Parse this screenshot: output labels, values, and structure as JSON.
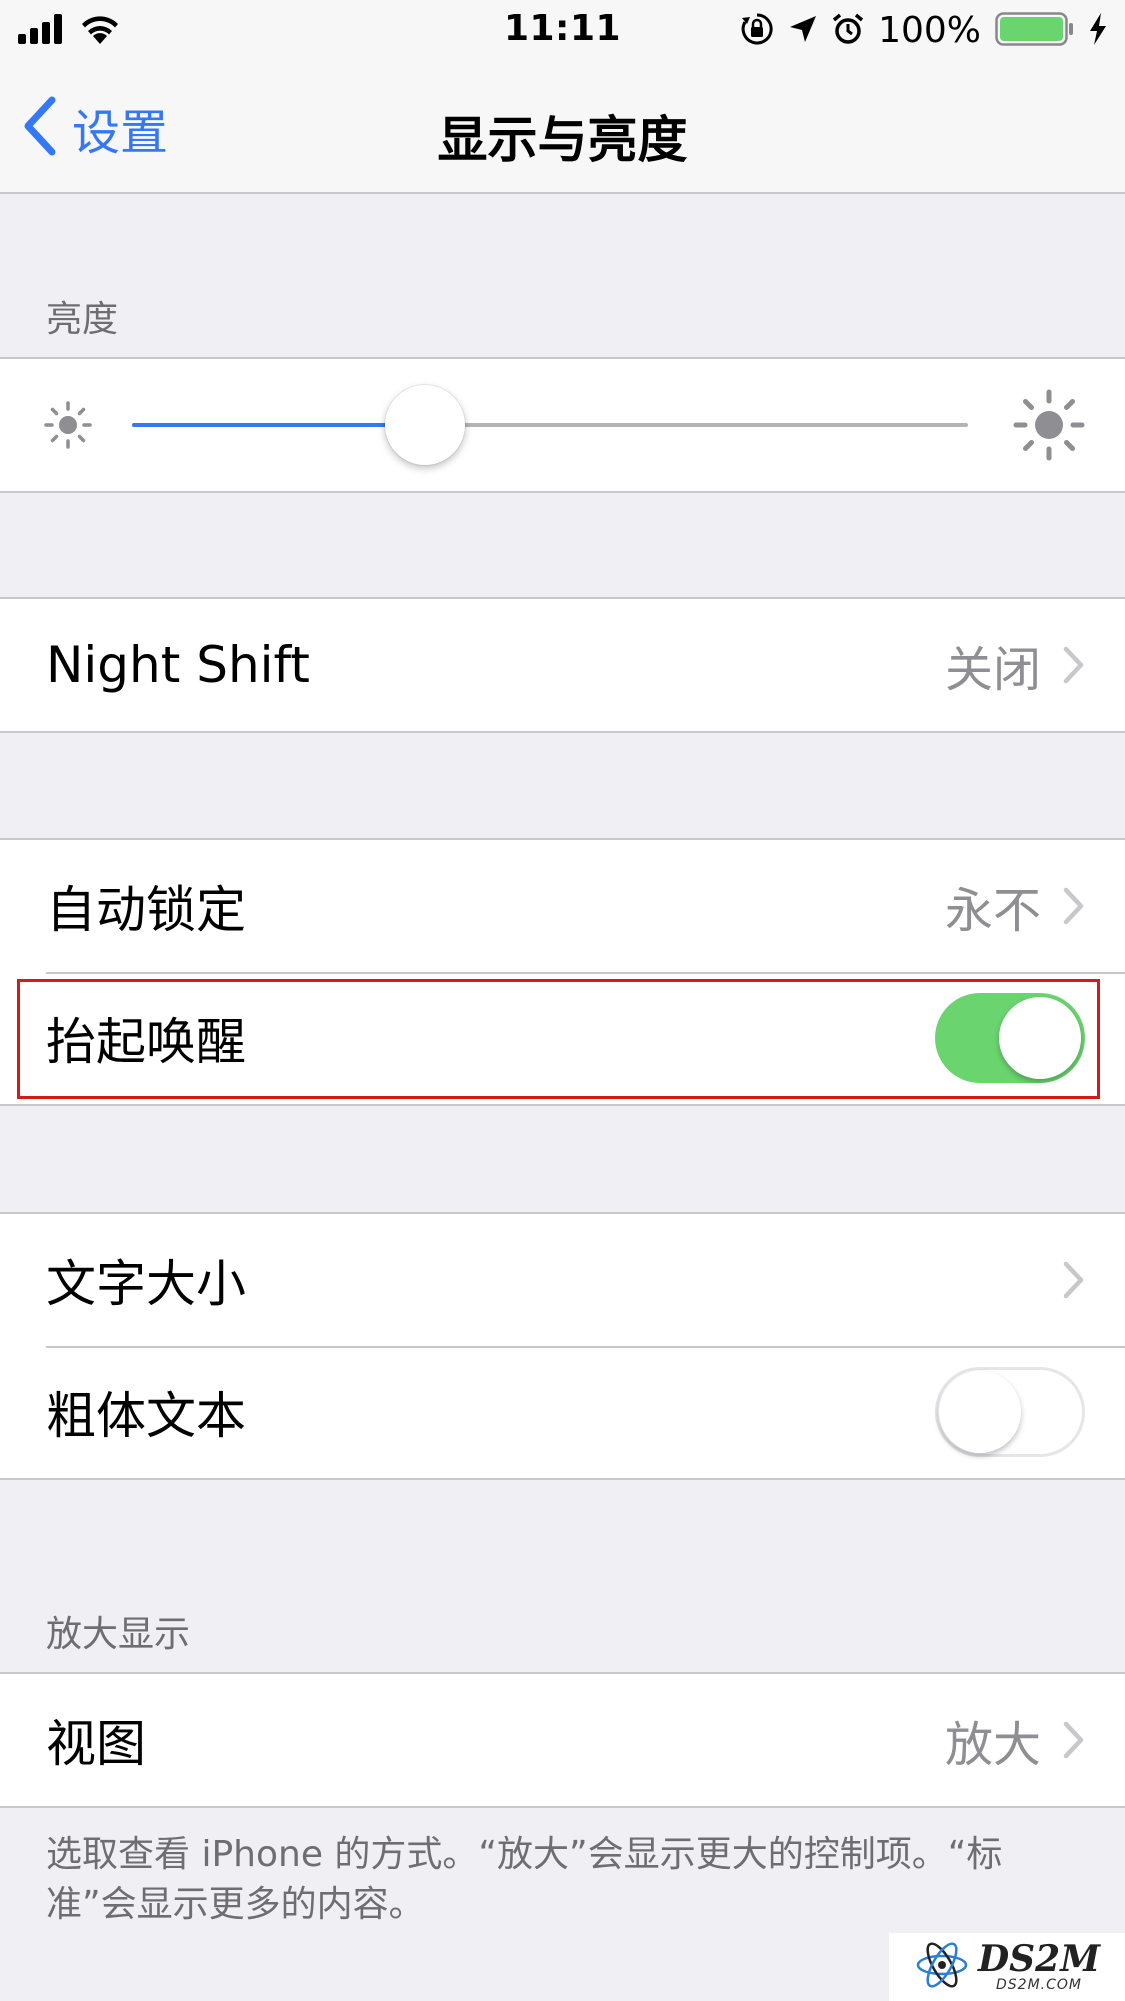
{
  "status_bar": {
    "time": "11:11",
    "battery_percent": "100%",
    "battery_level": 1.0,
    "icons": [
      "signal-icon",
      "wifi-icon",
      "orientation-lock-icon",
      "location-icon",
      "alarm-icon",
      "battery-icon",
      "charging-icon"
    ]
  },
  "nav": {
    "back_label": "设置",
    "title": "显示与亮度"
  },
  "brightness": {
    "header": "亮度",
    "level": 0.35
  },
  "night_shift": {
    "label": "Night Shift",
    "value": "关闭"
  },
  "auto_lock": {
    "label": "自动锁定",
    "value": "永不"
  },
  "raise_to_wake": {
    "label": "抬起唤醒",
    "on": true
  },
  "text_size": {
    "label": "文字大小"
  },
  "bold_text": {
    "label": "粗体文本",
    "on": false
  },
  "zoom": {
    "header": "放大显示",
    "view_label": "视图",
    "view_value": "放大",
    "footer": "选取查看 iPhone 的方式。“放大”会显示更大的控制项。“标准”会显示更多的内容。"
  },
  "watermark": {
    "text": "DS2M",
    "sub": "DS2M.COM"
  },
  "colors": {
    "accent": "#3478f6",
    "toggle_on": "#6ad46f",
    "highlight": "#d61a1a",
    "background": "#efeff4"
  }
}
